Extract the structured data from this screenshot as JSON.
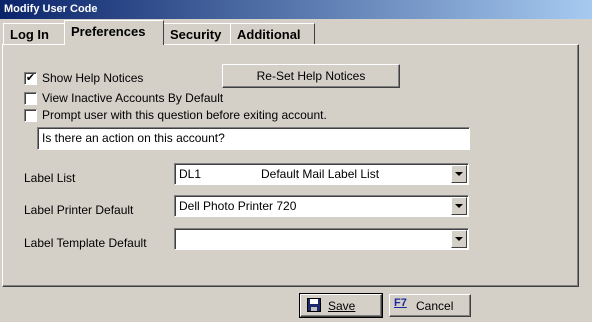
{
  "window": {
    "title": "Modify User Code"
  },
  "tabs": [
    {
      "label": "Log In"
    },
    {
      "label": "Preferences"
    },
    {
      "label": "Security"
    },
    {
      "label": "Additional"
    }
  ],
  "preferences": {
    "show_help_notices": {
      "label": "Show Help Notices",
      "checked": true
    },
    "reset_help_notices_label": "Re-Set Help Notices",
    "view_inactive": {
      "label": "View Inactive Accounts By Default",
      "checked": false
    },
    "prompt_user": {
      "label": "Prompt user with this question before exiting account.",
      "checked": false
    },
    "prompt_question": "Is there an action on this account?",
    "label_list": {
      "label": "Label List",
      "code": "DL1",
      "description": "Default Mail Label List"
    },
    "label_printer": {
      "label": "Label Printer Default",
      "value": "Dell Photo Printer 720"
    },
    "label_template": {
      "label": "Label Template Default",
      "value": ""
    }
  },
  "footer": {
    "save_label": "Save",
    "cancel_shortcut": "F7",
    "cancel_label": "Cancel"
  },
  "colors": {
    "window_bg": "#d4d0c8",
    "titlebar_start": "#0a246a",
    "titlebar_end": "#a6caf0"
  },
  "icons": {
    "save": "floppy-disk-icon",
    "cancel": "f7-key-icon"
  }
}
